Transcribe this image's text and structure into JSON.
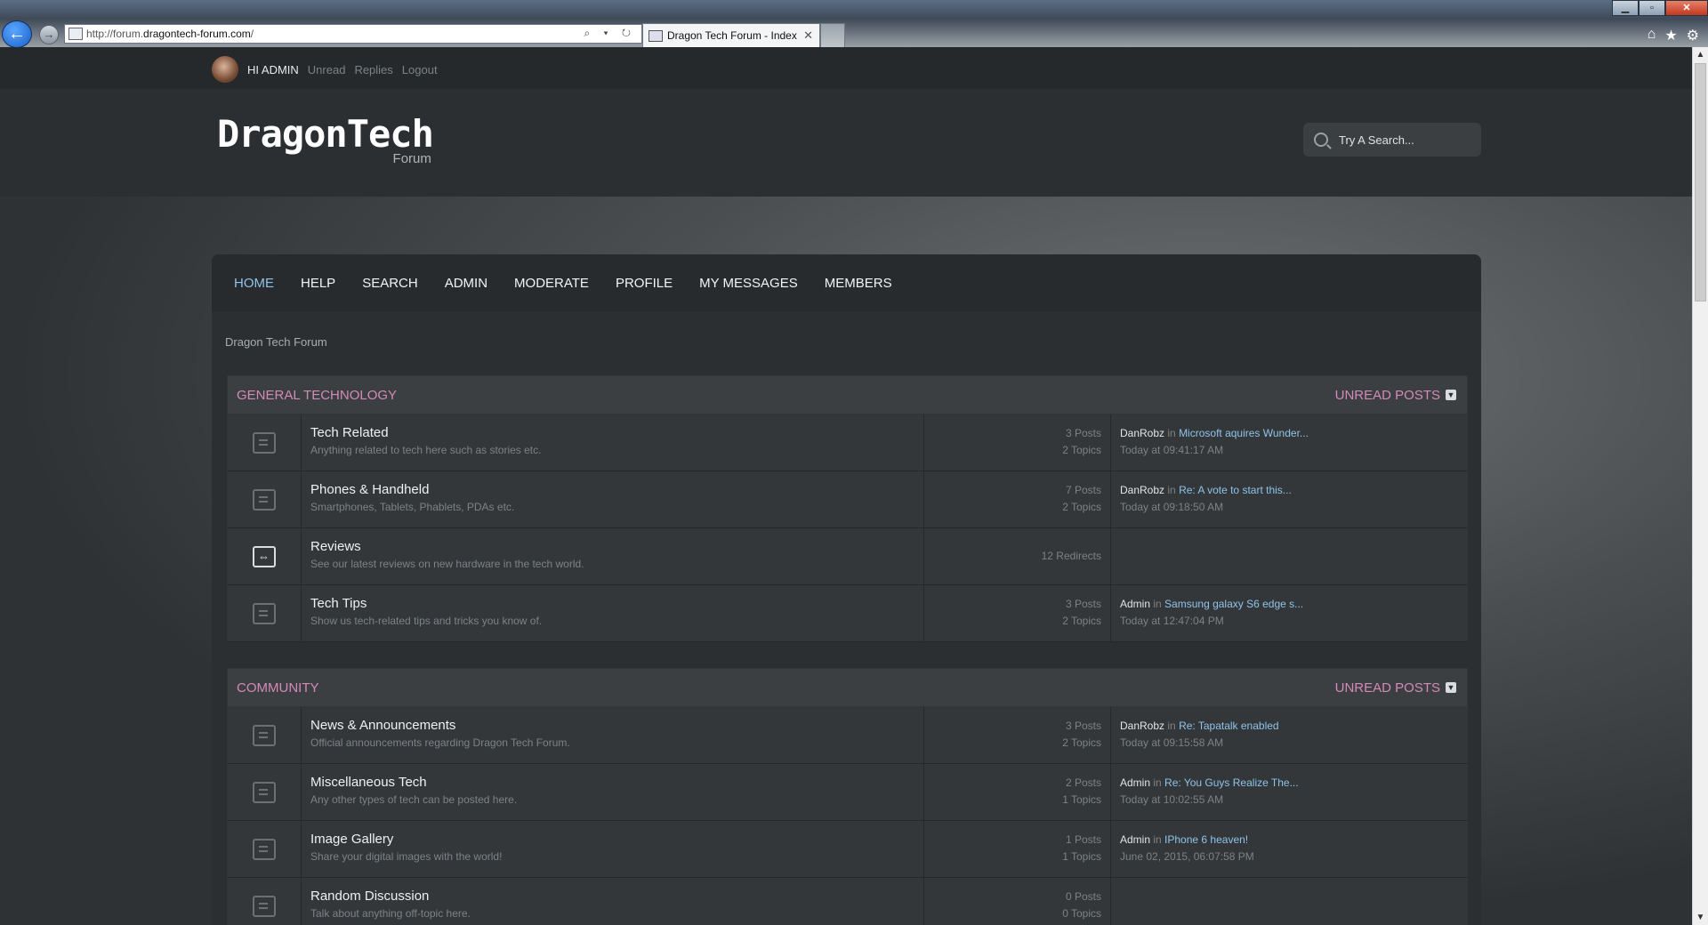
{
  "browser": {
    "url_prefix": "http://forum.",
    "url_domain": "dragontech-forum.com",
    "url_suffix": "/",
    "tab_title": "Dragon Tech Forum - Index",
    "tab_close": "✕",
    "back_icon": "←",
    "forward_icon": "→",
    "addr_tools": "⌕ ▾ ↻",
    "home_icon": "⌂",
    "star_icon": "★",
    "gear_icon": "⚙",
    "minimize": "▁",
    "maximize": "▫",
    "close": "✕"
  },
  "userbar": {
    "greeting": "HI ADMIN",
    "links": [
      "Unread",
      "Replies",
      "Logout"
    ]
  },
  "header": {
    "logo_main": "DragonTech",
    "logo_sub": "Forum",
    "search_placeholder": "Try A Search..."
  },
  "nav": {
    "items": [
      "HOME",
      "HELP",
      "SEARCH",
      "ADMIN",
      "MODERATE",
      "PROFILE",
      "MY MESSAGES",
      "MEMBERS"
    ],
    "active": "HOME"
  },
  "breadcrumb": "Dragon Tech Forum",
  "categories": [
    {
      "title": "GENERAL TECHNOLOGY",
      "unread_label": "UNREAD POSTS",
      "boards": [
        {
          "name": "Tech Related",
          "desc": "Anything related to tech here such as stories etc.",
          "posts": "3 Posts",
          "topics": "2 Topics",
          "last_user": "DanRobz",
          "in": "in",
          "last_topic": "Microsoft aquires Wunder...",
          "last_time": "Today at 09:41:17 AM"
        },
        {
          "name": "Phones & Handheld",
          "desc": "Smartphones, Tablets, Phablets, PDAs etc.",
          "posts": "7 Posts",
          "topics": "2 Topics",
          "last_user": "DanRobz",
          "in": "in",
          "last_topic": "Re: A vote to start this...",
          "last_time": "Today at 09:18:50 AM"
        },
        {
          "name": "Reviews",
          "desc": "See our latest reviews on new hardware in the tech world.",
          "redirects": "12 Redirects"
        },
        {
          "name": "Tech Tips",
          "desc": "Show us tech-related tips and tricks you know of.",
          "posts": "3 Posts",
          "topics": "2 Topics",
          "last_user": "Admin",
          "in": "in",
          "last_topic": "Samsung galaxy S6 edge s...",
          "last_time": "Today at 12:47:04 PM"
        }
      ]
    },
    {
      "title": "COMMUNITY",
      "unread_label": "UNREAD POSTS",
      "boards": [
        {
          "name": "News & Announcements",
          "desc": "Official announcements regarding Dragon Tech Forum.",
          "posts": "3 Posts",
          "topics": "2 Topics",
          "last_user": "DanRobz",
          "in": "in",
          "last_topic": "Re: Tapatalk enabled",
          "last_time": "Today at 09:15:58 AM"
        },
        {
          "name": "Miscellaneous Tech",
          "desc": "Any other types of tech can be posted here.",
          "posts": "2 Posts",
          "topics": "1 Topics",
          "last_user": "Admin",
          "in": "in",
          "last_topic": "Re: You Guys Realize The...",
          "last_time": "Today at 10:02:55 AM"
        },
        {
          "name": "Image Gallery",
          "desc": "Share your digital images with the world!",
          "posts": "1 Posts",
          "topics": "1 Topics",
          "last_user": "Admin",
          "in": "in",
          "last_topic": "IPhone 6 heaven!",
          "last_time": "June 02, 2015, 06:07:58 PM"
        },
        {
          "name": "Random Discussion",
          "desc": "Talk about anything off-topic here.",
          "posts": "0 Posts",
          "topics": "0 Topics"
        }
      ]
    }
  ],
  "colors": {
    "accent_pink": "#d48ab8",
    "link_blue": "#8fc3e8"
  }
}
